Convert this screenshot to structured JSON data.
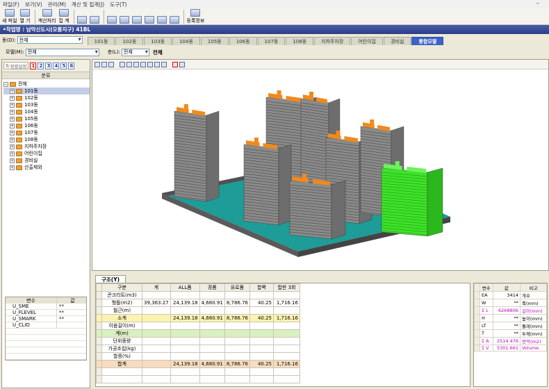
{
  "menu": {
    "items": [
      "파일(F)",
      "보기(V)",
      "관리(M)",
      "계산 및 집계(J)",
      "도구(T)"
    ]
  },
  "toolbar": {
    "new_label": "새 파일",
    "open_label": "열 기",
    "calc_label": "계산처리",
    "sum_label": "집 계",
    "reg_label": "등록정보"
  },
  "project": {
    "title": "•작업명 : 남악신도시(오룡지구) 41BL"
  },
  "dong": {
    "label": "동(D):",
    "value": "전체",
    "tabs": [
      "101동",
      "102동",
      "103동",
      "104동",
      "105동",
      "106동",
      "107동",
      "108동",
      "지하주차장",
      "어린이집",
      "경비실",
      "통합모델"
    ],
    "active_tab": "통합모델"
  },
  "filter": {
    "model_label": "모델(M):",
    "model_value": "전체",
    "floor_label": "층(L):",
    "floor_value": "전체",
    "floor_display": "전체"
  },
  "left": {
    "sort_label": "정렬설정",
    "num_buttons": [
      "1",
      "2",
      "3",
      "4",
      "5",
      "6"
    ],
    "tree_header": "분류",
    "tree_root": "전체",
    "tree_items": [
      "101동",
      "102동",
      "103동",
      "104동",
      "105동",
      "106동",
      "107동",
      "108동",
      "지하주차장",
      "어린이집",
      "경비실",
      "산출제외"
    ],
    "selected_item": "101동"
  },
  "vars": {
    "headers": [
      "변수",
      "값"
    ],
    "rows": [
      {
        "name": "U_SME",
        "val": "**"
      },
      {
        "name": "U_FLEVEL",
        "val": "**"
      },
      {
        "name": "U_SMARK",
        "val": "**"
      },
      {
        "name": "U_CLID",
        "val": ""
      }
    ]
  },
  "bottom": {
    "tab_label": "구조(Y)",
    "headers": [
      "구분",
      "계",
      "ALL폼",
      "경폼",
      "유로폼",
      "합벽",
      "합판 3회"
    ],
    "rows": [
      {
        "label": "콘크리트(m3)",
        "cells": [
          "",
          "",
          "",
          "",
          "",
          ""
        ],
        "style": ""
      },
      {
        "label": "형틀(m2)",
        "cells": [
          "39,363.27",
          "24,139.18",
          "4,680.91",
          "8,786.76",
          "40.25",
          "1,716.16"
        ],
        "style": ""
      },
      {
        "label": "철근(m)",
        "cells": [
          "",
          "",
          "",
          "",
          "",
          ""
        ],
        "style": ""
      },
      {
        "label": "소계",
        "cells": [
          "",
          "24,139.18",
          "4,680.91",
          "8,786.76",
          "40.25",
          "1,716.16"
        ],
        "style": "yellow"
      },
      {
        "label": "이음길이(m)",
        "cells": [
          "",
          "",
          "",
          "",
          "",
          ""
        ],
        "style": ""
      },
      {
        "label": "계(m)",
        "cells": [
          "",
          "",
          "",
          "",
          "",
          ""
        ],
        "style": "green"
      },
      {
        "label": "단위중량",
        "cells": [
          "",
          "",
          "",
          "",
          "",
          ""
        ],
        "style": ""
      },
      {
        "label": "가공조립(kg)",
        "cells": [
          "",
          "",
          "",
          "",
          "",
          ""
        ],
        "style": ""
      },
      {
        "label": "할증(%)",
        "cells": [
          "",
          "",
          "",
          "",
          "",
          ""
        ],
        "style": ""
      },
      {
        "label": "합계",
        "cells": [
          "",
          "24,139.18",
          "4,680.91",
          "8,786.76",
          "40.25",
          "1,716.16"
        ],
        "style": "orange"
      }
    ]
  },
  "props": {
    "headers": [
      "변수",
      "값",
      "비고"
    ],
    "rows": [
      {
        "name": "EA",
        "val": "3414",
        "note": "개수",
        "pink": false
      },
      {
        "name": "W",
        "val": "**",
        "note": "폭(mm)",
        "pink": false
      },
      {
        "name": "Σ L",
        "val": "6268806",
        "note": "길이(mm)",
        "pink": true
      },
      {
        "name": "H",
        "val": "**",
        "note": "높이(mm)",
        "pink": false
      },
      {
        "name": "LT",
        "val": "**",
        "note": "둘레(mm)",
        "pink": false
      },
      {
        "name": "T",
        "val": "**",
        "note": "두께(mm)",
        "pink": false
      },
      {
        "name": "Σ A",
        "val": "2514.476",
        "note": "면적(m2)",
        "pink": true
      },
      {
        "name": "Σ V",
        "val": "5301.661",
        "note": "Volume",
        "pink": true
      }
    ]
  },
  "colors": {
    "accent": "#3e61c6",
    "building": "#8a8a8a",
    "roof": "#f08a1c",
    "selected": "#3fe22a",
    "ground": "#1d9c98"
  }
}
